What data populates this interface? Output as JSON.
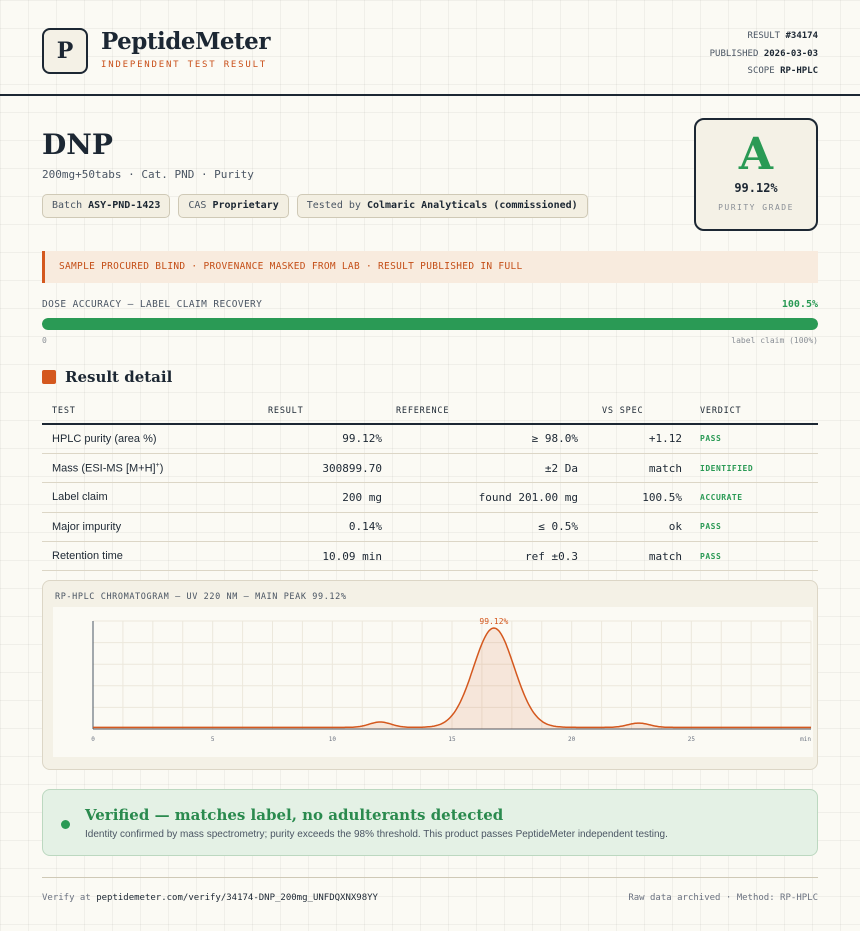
{
  "header": {
    "logo_letter": "P",
    "brand": "PeptideMeter",
    "brand_sub": "INDEPENDENT TEST RESULT",
    "result_label": "RESULT",
    "result_value": "#34174",
    "published_label": "PUBLISHED",
    "published_value": "2026-03-03",
    "scope_label": "SCOPE",
    "scope_value": "RP-HPLC"
  },
  "product": {
    "name": "DNP",
    "subtitle": "200mg+50tabs · Cat. PND · Purity",
    "batch_label": "Batch",
    "batch_value": "ASY-PND-1423",
    "cas_label": "CAS",
    "cas_value": "Proprietary",
    "tested_label": "Tested by",
    "tested_value": "Colmaric Analyticals (commissioned)"
  },
  "grade": {
    "letter": "A",
    "value": "99.12%",
    "label": "PURITY GRADE"
  },
  "notice": "SAMPLE PROCURED BLIND · PROVENANCE MASKED FROM LAB · RESULT PUBLISHED IN FULL",
  "dose": {
    "label": "DOSE ACCURACY — LABEL CLAIM RECOVERY",
    "value_text": "100.5%",
    "fill_fraction": 1.0,
    "min_label": "0",
    "max_label": "label claim (100%)"
  },
  "section_title": "Result detail",
  "table": {
    "headers": [
      "TEST",
      "RESULT",
      "REFERENCE",
      "VS SPEC",
      "VERDICT"
    ],
    "rows": [
      {
        "test": "HPLC purity (area %)",
        "test_sup": "",
        "result": "99.12%",
        "reference": "≥ 98.0%",
        "vs": "+1.12",
        "verdict": "PASS"
      },
      {
        "test": "Mass (ESI-MS [M+H]",
        "test_sup": "+",
        "test_end": ")",
        "result": "300899.70",
        "reference": "±2 Da",
        "vs": "match",
        "verdict": "IDENTIFIED"
      },
      {
        "test": "Label claim",
        "test_sup": "",
        "result": "200 mg",
        "reference": "found 201.00 mg",
        "vs": "100.5%",
        "verdict": "ACCURATE"
      },
      {
        "test": "Major impurity",
        "test_sup": "",
        "result": "0.14%",
        "reference": "≤ 0.5%",
        "vs": "ok",
        "verdict": "PASS"
      },
      {
        "test": "Retention time",
        "test_sup": "",
        "result": "10.09 min",
        "reference": "ref ±0.3",
        "vs": "match",
        "verdict": "PASS"
      }
    ]
  },
  "chromatogram": {
    "label": "RP-HPLC CHROMATOGRAM — UV 220 NM — MAIN PEAK 99.12%"
  },
  "chart_data": {
    "type": "line",
    "title": "RP-HPLC CHROMATOGRAM — UV 220 NM — MAIN PEAK 99.12%",
    "xlabel": "",
    "ylabel": "",
    "x_ticks": [
      "0",
      "5",
      "10",
      "15",
      "20",
      "25",
      "min"
    ],
    "xlim": [
      0,
      30
    ],
    "ylim": [
      0,
      100
    ],
    "peak_label": "99.12%",
    "peaks": [
      {
        "center": 12.0,
        "height": 5,
        "width": 0.45
      },
      {
        "center": 16.75,
        "height": 92,
        "width": 0.85
      },
      {
        "center": 22.8,
        "height": 4,
        "width": 0.45
      }
    ],
    "baseline": 1.5,
    "color": "#d4581e",
    "grid": true
  },
  "verify": {
    "title": "Verified — matches label, no adulterants detected",
    "text": "Identity confirmed by mass spectrometry; purity exceeds the 98% threshold. This product passes PeptideMeter independent testing."
  },
  "footer": {
    "verify_prefix": "Verify at",
    "verify_url": "peptidemeter.com/verify/34174-DNP_200mg_UNFDQXNX98YY",
    "right": "Raw data archived · Method: RP-HPLC"
  },
  "colors": {
    "accent": "#d4581e",
    "pass": "#2a9a55",
    "ink": "#1c2733"
  }
}
